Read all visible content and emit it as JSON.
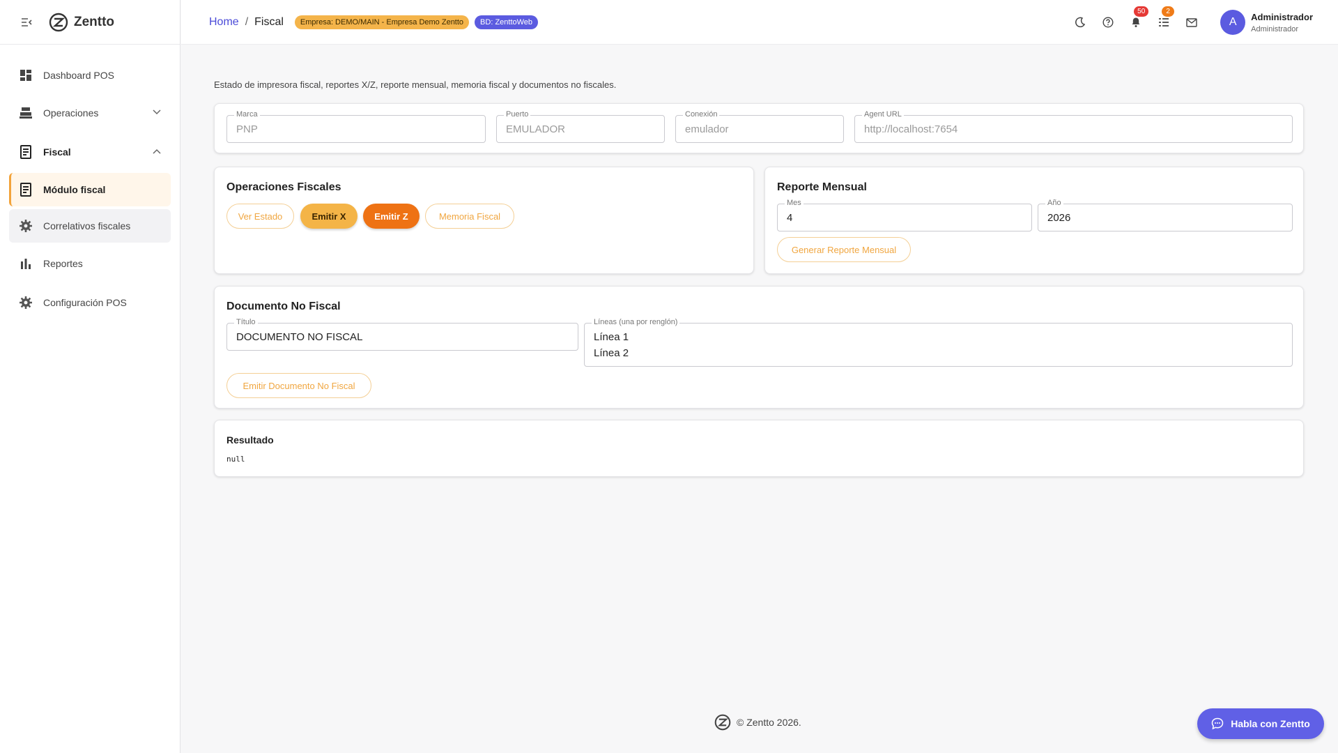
{
  "app": {
    "name": "Zentto"
  },
  "sidebar": {
    "items": [
      {
        "label": "Dashboard POS",
        "icon": "dashboard-icon"
      },
      {
        "label": "Operaciones",
        "icon": "cash-register-icon"
      },
      {
        "label": "Fiscal",
        "icon": "receipt-icon"
      },
      {
        "label": "Módulo fiscal",
        "icon": "receipt-icon"
      },
      {
        "label": "Correlativos fiscales",
        "icon": "gear-icon"
      },
      {
        "label": "Reportes",
        "icon": "bar-chart-icon"
      },
      {
        "label": "Configuración POS",
        "icon": "gear-icon"
      }
    ]
  },
  "header": {
    "breadcrumb_home": "Home",
    "breadcrumb_sep": "/",
    "breadcrumb_current": "Fiscal",
    "chip_empresa": "Empresa: DEMO/MAIN - Empresa Demo Zentto",
    "chip_bd": "BD: ZenttoWeb",
    "notifications_count": "50",
    "tasks_count": "2",
    "avatar_letter": "A",
    "user_name": "Administrador",
    "user_role": "Administrador"
  },
  "page": {
    "description": "Estado de impresora fiscal, reportes X/Z, reporte mensual, memoria fiscal y documentos no fiscales."
  },
  "config": {
    "marca_label": "Marca",
    "marca_value": "PNP",
    "puerto_label": "Puerto",
    "puerto_value": "EMULADOR",
    "conexion_label": "Conexión",
    "conexion_value": "emulador",
    "agent_label": "Agent URL",
    "agent_value": "http://localhost:7654"
  },
  "operaciones": {
    "title": "Operaciones Fiscales",
    "ver_estado": "Ver Estado",
    "emitir_x": "Emitir X",
    "emitir_z": "Emitir Z",
    "memoria": "Memoria Fiscal"
  },
  "reporte": {
    "title": "Reporte Mensual",
    "mes_label": "Mes",
    "mes_value": "4",
    "anio_label": "Año",
    "anio_value": "2026",
    "generar": "Generar Reporte Mensual"
  },
  "documento": {
    "title": "Documento No Fiscal",
    "titulo_label": "Título",
    "titulo_value": "DOCUMENTO NO FISCAL",
    "lineas_label": "Líneas (una por renglón)",
    "linea1": "Línea 1",
    "linea2": "Línea 2",
    "emitir": "Emitir Documento No Fiscal"
  },
  "resultado": {
    "title": "Resultado",
    "value": "null"
  },
  "footer": {
    "text": "© Zentto 2026."
  },
  "chat": {
    "label": "Habla con Zentto"
  },
  "colors": {
    "accent": "#f4b447",
    "primary": "#5b5be0",
    "orange": "#ee7214"
  }
}
